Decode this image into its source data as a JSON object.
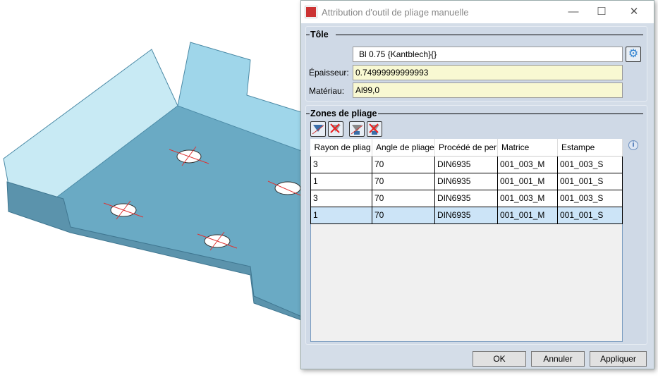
{
  "dialog": {
    "title": "Attribution d'outil de pliage manuelle",
    "minimize": "—",
    "maximize": "☐",
    "close": "✕"
  },
  "sheet": {
    "group_title": "Tôle",
    "sheet_name": "Bl 0.75 {Kantblech}{}",
    "thickness_label": "Épaisseur:",
    "thickness": "0.74999999999993",
    "material_label": "Matériau:",
    "material": "Al99,0"
  },
  "zones": {
    "group_title": "Zones de pliage",
    "columns": [
      "Rayon de pliag",
      "Angle de pliage",
      "Procédé de per",
      "Matrice",
      "Estampe"
    ],
    "rows": [
      [
        "3",
        "70",
        "DIN6935",
        "001_003_M",
        "001_003_S"
      ],
      [
        "1",
        "70",
        "DIN6935",
        "001_001_M",
        "001_001_S"
      ],
      [
        "3",
        "70",
        "DIN6935",
        "001_003_M",
        "001_003_S"
      ],
      [
        "1",
        "70",
        "DIN6935",
        "001_001_M",
        "001_001_S"
      ]
    ],
    "selected_row": 3
  },
  "buttons": {
    "ok": "OK",
    "cancel": "Annuler",
    "apply": "Appliquer"
  },
  "colors": {
    "sheet_face": "#6aaac4",
    "sheet_light": "#9fd6ea",
    "field_yellow": "#f8f8d2",
    "selection": "#cce4f7"
  }
}
